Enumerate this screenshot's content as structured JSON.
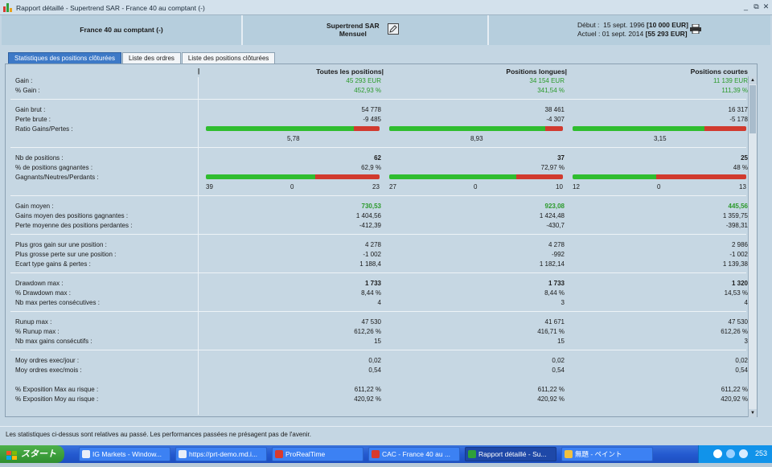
{
  "window": {
    "title": "Rapport détaillé - Supertrend SAR - France 40 au comptant (-)",
    "controls": [
      "_",
      "⧉",
      "✕"
    ]
  },
  "header": {
    "instrument": "France 40 au comptant (-)",
    "strategy_line1": "Supertrend SAR",
    "strategy_line2": "Mensuel",
    "debut_label": "Début :",
    "debut_date": "15 sept. 1996",
    "debut_value": "[10 000 EUR]",
    "actuel_label": "Actuel :",
    "actuel_date": "01 sept. 2014",
    "actuel_value": "[55 293 EUR]"
  },
  "tabs": [
    {
      "label": "Statistiques des positions clôturées",
      "active": true
    },
    {
      "label": "Liste des ordres",
      "active": false
    },
    {
      "label": "Liste des positions clôturées",
      "active": false
    }
  ],
  "columns": {
    "all": "Toutes les positions|",
    "long": "Positions longues|",
    "short": "Positions courtes",
    "marker": "|"
  },
  "stats": {
    "gain": {
      "label": "Gain :",
      "all": "45 293 EUR",
      "long": "34 154 EUR",
      "short": "11 139 EUR"
    },
    "pct_gain": {
      "label": "% Gain :",
      "all": "452,93 %",
      "long": "341,54 %",
      "short": "111,39 %"
    },
    "gain_brut": {
      "label": "Gain brut :",
      "all": "54 778",
      "long": "38 461",
      "short": "16 317"
    },
    "perte_brute": {
      "label": "Perte brute :",
      "all": "-9 485",
      "long": "-4 307",
      "short": "-5 178"
    },
    "ratio": {
      "label": "Ratio Gains/Pertes :",
      "all": "5,78",
      "long": "8,93",
      "short": "3,15",
      "fill_all": 0.85,
      "fill_long": 0.9,
      "fill_short": 0.76
    },
    "nb_positions": {
      "label": "Nb de positions :",
      "all": "62",
      "long": "37",
      "short": "25"
    },
    "pct_gagnantes": {
      "label": "% de positions gagnantes :",
      "all": "62,9 %",
      "long": "72,97 %",
      "short": "48 %"
    },
    "gnp": {
      "label": "Gagnants/Neutres/Perdants :",
      "all": {
        "g": "39",
        "n": "0",
        "p": "23",
        "fill": 0.629
      },
      "long": {
        "g": "27",
        "n": "0",
        "p": "10",
        "fill": 0.73
      },
      "short": {
        "g": "12",
        "n": "0",
        "p": "13",
        "fill": 0.48
      }
    },
    "gain_moyen": {
      "label": "Gain moyen :",
      "all": "730,53",
      "long": "923,08",
      "short": "445,56"
    },
    "gains_moyen_gagnantes": {
      "label": "Gains moyen des positions gagnantes :",
      "all": "1 404,56",
      "long": "1 424,48",
      "short": "1 359,75"
    },
    "perte_moyenne": {
      "label": "Perte moyenne des positions perdantes :",
      "all": "-412,39",
      "long": "-430,7",
      "short": "-398,31"
    },
    "plus_gros_gain": {
      "label": "Plus gros gain sur une position :",
      "all": "4 278",
      "long": "4 278",
      "short": "2 986"
    },
    "plus_grosse_perte": {
      "label": "Plus grosse perte sur une position :",
      "all": "-1 002",
      "long": "-992",
      "short": "-1 002"
    },
    "ecart_type": {
      "label": "Ecart type gains & pertes :",
      "all": "1 188,4",
      "long": "1 182,14",
      "short": "1 139,38"
    },
    "drawdown": {
      "label": "Drawdown max :",
      "all": "1 733",
      "long": "1 733",
      "short": "1 320"
    },
    "pct_drawdown": {
      "label": "% Drawdown max :",
      "all": "8,44 %",
      "long": "8,44 %",
      "short": "14,53 %"
    },
    "nb_pertes": {
      "label": "Nb max pertes consécutives :",
      "all": "4",
      "long": "3",
      "short": "4"
    },
    "runup": {
      "label": "Runup max :",
      "all": "47 530",
      "long": "41 671",
      "short": "47 530"
    },
    "pct_runup": {
      "label": "% Runup max :",
      "all": "612,26 %",
      "long": "416,71 %",
      "short": "612,26 %"
    },
    "nb_gains": {
      "label": "Nb max gains consécutifs :",
      "all": "15",
      "long": "15",
      "short": "3"
    },
    "ordres_jour": {
      "label": "Moy ordres exec/jour :",
      "all": "0,02",
      "long": "0,02",
      "short": "0,02"
    },
    "ordres_mois": {
      "label": "Moy ordres exec/mois :",
      "all": "0,54",
      "long": "0,54",
      "short": "0,54"
    },
    "expo_max": {
      "label": "% Exposition Max au risque :",
      "all": "611,22 %",
      "long": "611,22 %",
      "short": "611,22 %"
    },
    "expo_moy": {
      "label": "% Exposition Moy au risque :",
      "all": "420,92 %",
      "long": "420,92 %",
      "short": "420,92 %"
    }
  },
  "disclaimer": "Les statistiques ci-dessus sont relatives au passé. Les performances passées ne présagent pas de l'avenir.",
  "taskbar": {
    "start": "スタート",
    "items": [
      {
        "label": "IG Markets - Window...",
        "active": false
      },
      {
        "label": "https://prt-demo.md.i...",
        "active": false
      },
      {
        "label": "ProRealTime",
        "active": false
      },
      {
        "label": "CAC - France 40 au ...",
        "active": false
      },
      {
        "label": "Rapport détaillé - Su...",
        "active": true
      },
      {
        "label": "無題 - ペイント",
        "active": false
      }
    ],
    "clock": "253"
  },
  "colors": {
    "accent": "#3d79c7",
    "gain_green": "#2b9a2b",
    "bar_green": "#2fbd2f",
    "bar_red": "#d13a2e"
  }
}
